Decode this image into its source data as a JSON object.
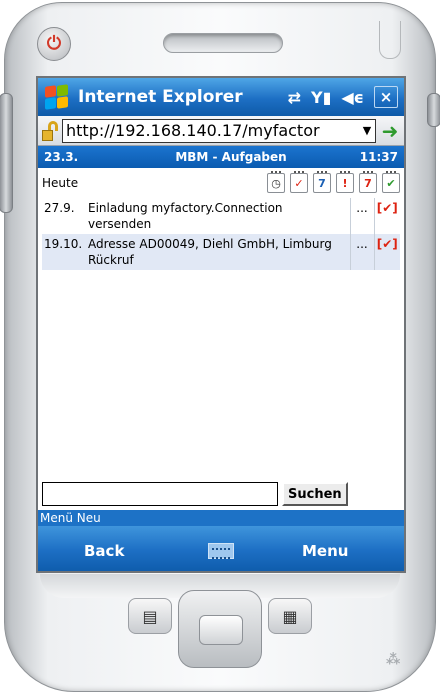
{
  "titlebar": {
    "app_title": "Internet Explorer",
    "status_icons": [
      "connectivity-icon",
      "signal-icon",
      "volume-icon"
    ],
    "close_label": "×"
  },
  "addressbar": {
    "url": "http://192.168.140.17/myfactor"
  },
  "page_header": {
    "date": "23.3.",
    "title": "MBM - Aufgaben",
    "time": "11:37"
  },
  "section": {
    "label": "Heute",
    "tool_icons": [
      "clock-note-icon",
      "red-note-icon",
      "blue-note-icon",
      "red-flag-note-icon",
      "orange-note-icon",
      "green-check-note-icon"
    ]
  },
  "tasks": [
    {
      "date": "27.9.",
      "text": "Einladung myfactory.Connection versenden",
      "more": "...",
      "mark": "[✔]"
    },
    {
      "date": "19.10.",
      "text": "Adresse AD00049, Diehl GmbH, Limburg Rückruf",
      "more": "...",
      "mark": "[✔]"
    }
  ],
  "search": {
    "value": "",
    "button_label": "Suchen"
  },
  "menu_hint": "Menü Neu",
  "softkeys": {
    "left": "Back",
    "right": "Menu"
  },
  "colors": {
    "accent_blue": "#1d6fc4",
    "row_alt": "#e1e8f5",
    "mark_red": "#dd2211"
  }
}
